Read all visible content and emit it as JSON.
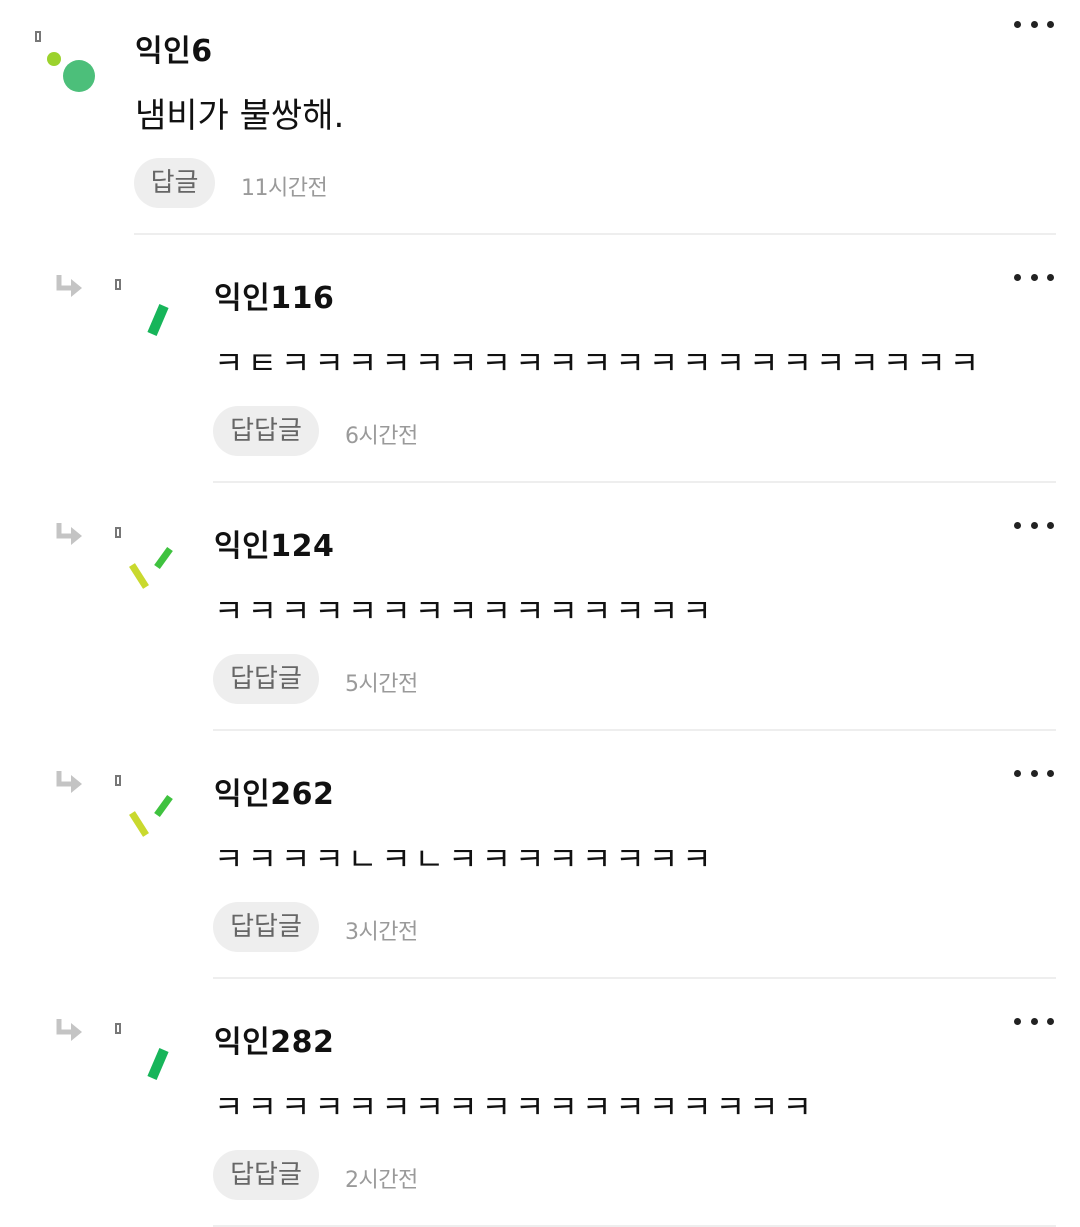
{
  "comments": [
    {
      "nickname": "익인6",
      "text": "냄비가 불쌍해.",
      "reply_label": "답글",
      "time": "11시간전",
      "avatar_icon": "dots-avatar-icon",
      "colors": {
        "dot_small": "#9bd22d",
        "dot_big": "#4cbf7a"
      }
    },
    {
      "nickname": "익인116",
      "text": "ㅋㅌㅋㅋㅋㅋㅋㅋㅋㅋㅋㅋㅋㅋㅋㅋㅋㅋㅋㅋㅋㅋㅋ",
      "reply_label": "답답글",
      "time": "6시간전",
      "avatar_icon": "single-bar-avatar-icon",
      "colors": {
        "bar": "#17b55a"
      }
    },
    {
      "nickname": "익인124",
      "text": "ㅋㅋㅋㅋㅋㅋㅋㅋㅋㅋㅋㅋㅋㅋㅋ",
      "reply_label": "답답글",
      "time": "5시간전",
      "avatar_icon": "double-bar-avatar-icon",
      "colors": {
        "bar_left": "#c9d92e",
        "bar_right": "#3fc23f"
      }
    },
    {
      "nickname": "익인262",
      "text": "ㅋㅋㅋㅋㄴㅋㄴㅋㅋㅋㅋㅋㅋㅋㅋ",
      "reply_label": "답답글",
      "time": "3시간전",
      "avatar_icon": "double-bar-avatar-icon",
      "colors": {
        "bar_left": "#c9d92e",
        "bar_right": "#3fc23f"
      }
    },
    {
      "nickname": "익인282",
      "text": "ㅋㅋㅋㅋㅋㅋㅋㅋㅋㅋㅋㅋㅋㅋㅋㅋㅋㅋ",
      "reply_label": "답답글",
      "time": "2시간전",
      "avatar_icon": "single-bar-avatar-icon",
      "colors": {
        "bar": "#17b55a"
      }
    }
  ]
}
